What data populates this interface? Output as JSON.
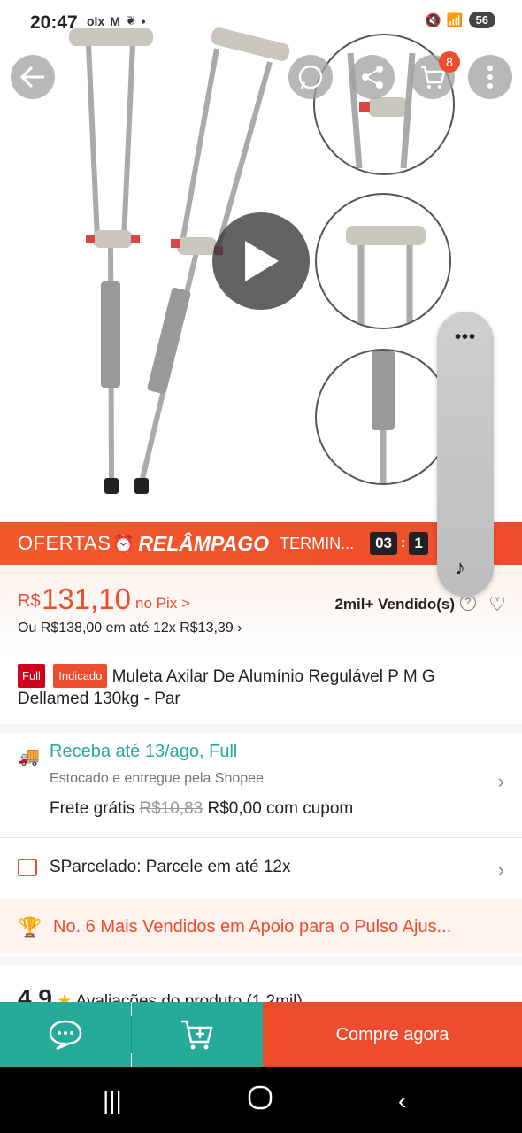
{
  "status_bar": {
    "time": "20:47",
    "left_icons": [
      "olx",
      "gmail",
      "leaf",
      "dot"
    ],
    "battery": "56"
  },
  "header": {
    "back_icon": "arrow-left-icon",
    "whatsapp_icon": "whatsapp-icon",
    "share_icon": "share-icon",
    "cart_icon": "cart-icon",
    "cart_count": "8",
    "more_icon": "more-vertical-icon"
  },
  "floating_panel": {
    "dots": "•••",
    "note_icon": "music-note-icon"
  },
  "flash_sale": {
    "ofertas": "OFERTAS",
    "relampago": "RELÂMPAGO",
    "termina": "TERMIN...",
    "timer_hours": "03",
    "timer_minutes": "1",
    "accent": "#ee4d2d"
  },
  "price": {
    "currency": "R$",
    "value": "131,10",
    "pix": "no Pix >",
    "installments": "Ou R$138,00 em até 12x R$13,39",
    "sold": "2mil+ Vendido(s)"
  },
  "product": {
    "badge_full": "Full",
    "badge_indicado": "Indicado",
    "title": "Muleta Axilar De Alumínio Regulável P M G Dellamed 130kg - Par"
  },
  "shipping": {
    "title": "Receba até 13/ago, Full",
    "subtitle": "Estocado e entregue pela Shopee",
    "free_label": "Frete grátis",
    "old_price": "R$10,83",
    "new_price": "R$0,00 com cupom",
    "color": "#26aa99"
  },
  "sparcelado": {
    "text": "SParcelado: Parcele em até 12x"
  },
  "bestseller": {
    "text": "No. 6 Mais Vendidos em Apoio para o Pulso Ajus..."
  },
  "reviews_peek": {
    "rating": "4.9",
    "label": "Avaliações do produto (1,2mil)"
  },
  "bottom_bar": {
    "chat_icon": "chat-icon",
    "add_cart_icon": "add-to-cart-icon",
    "buy_label": "Compre agora"
  }
}
